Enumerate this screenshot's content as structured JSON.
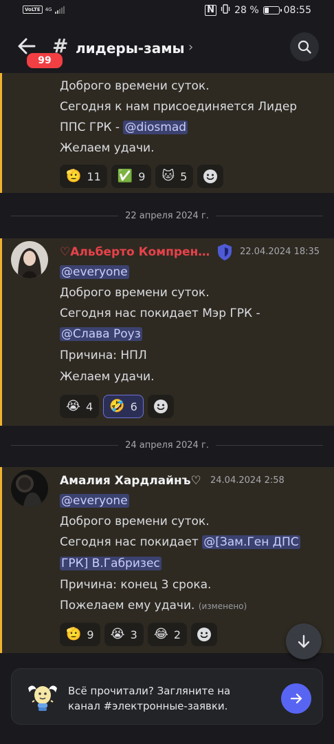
{
  "status_bar": {
    "volte": "VoLTE",
    "network": "4G",
    "battery": "28 %",
    "battery_level": 0.28,
    "time": "08:55"
  },
  "header": {
    "unread_badge": "99",
    "hash": "#",
    "channel_name": "лидеры-замы",
    "chevron": "›"
  },
  "messages": [
    {
      "lines": [
        {
          "text": "Доброго времени суток."
        },
        {
          "text": "Сегодня к нам присоединяется Лидер"
        },
        {
          "text": "ППС ГРК - ",
          "mention": "@diosmad"
        },
        {
          "text": "Желаем удачи."
        }
      ],
      "reactions": [
        {
          "emoji": "🫡",
          "count": "11",
          "icon": "salute-emoji"
        },
        {
          "emoji": "✅",
          "count": "9",
          "icon": "check-mark-emoji"
        },
        {
          "emoji": "🐱",
          "count": "5",
          "icon": "cat-sticker-emoji"
        }
      ]
    },
    {
      "date_divider": "22 апреля 2024 г.",
      "author": "♡Альберто Компрен…",
      "author_color": "#e8424a",
      "timestamp": "22.04.2024 18:35",
      "lines": [
        {
          "mention": "@everyone"
        },
        {
          "text": "Доброго времени суток."
        },
        {
          "text": "Сегодня нас покидает  Мэр  ГРК -"
        },
        {
          "mention": "@Слава Роуз"
        },
        {
          "text": "Причина: НПЛ"
        },
        {
          "text": "Желаем удачи."
        }
      ],
      "reactions": [
        {
          "emoji": "😭",
          "count": "4",
          "icon": "crying-emoji"
        },
        {
          "emoji": "🤣",
          "count": "6",
          "icon": "rofl-emoji",
          "selected": true
        }
      ]
    },
    {
      "date_divider": "24 апреля 2024 г.",
      "author": "Амалия Хардлайнъ♡",
      "author_color": "#f2f3f5",
      "timestamp": "24.04.2024 2:58",
      "lines": [
        {
          "mention": "@everyone"
        },
        {
          "text": "Доброго времени суток."
        },
        {
          "text": "Сегодня нас покидает ",
          "mention": "@[Зам.Ген ДПС"
        },
        {
          "mention": "ГРК] В.Габризес"
        },
        {
          "text": "Причина: конец 3 срока."
        },
        {
          "text": "Пожелаем ему удачи. ",
          "edited": "(изменено)"
        }
      ],
      "reactions": [
        {
          "emoji": "🫡",
          "count": "9",
          "icon": "salute-emoji"
        },
        {
          "emoji": "😭",
          "count": "3",
          "icon": "crying-emoji"
        },
        {
          "emoji": "😂",
          "count": "2",
          "icon": "joy-emoji"
        }
      ]
    }
  ],
  "footer": {
    "line1": "Всё прочитали? Загляните на",
    "line2": "канал #электронные-заявки."
  },
  "colors": {
    "accent": "#5865f2",
    "highlight_bar": "#f0b232",
    "mention_bg": "#3c4270",
    "badge": "#f23f43"
  }
}
